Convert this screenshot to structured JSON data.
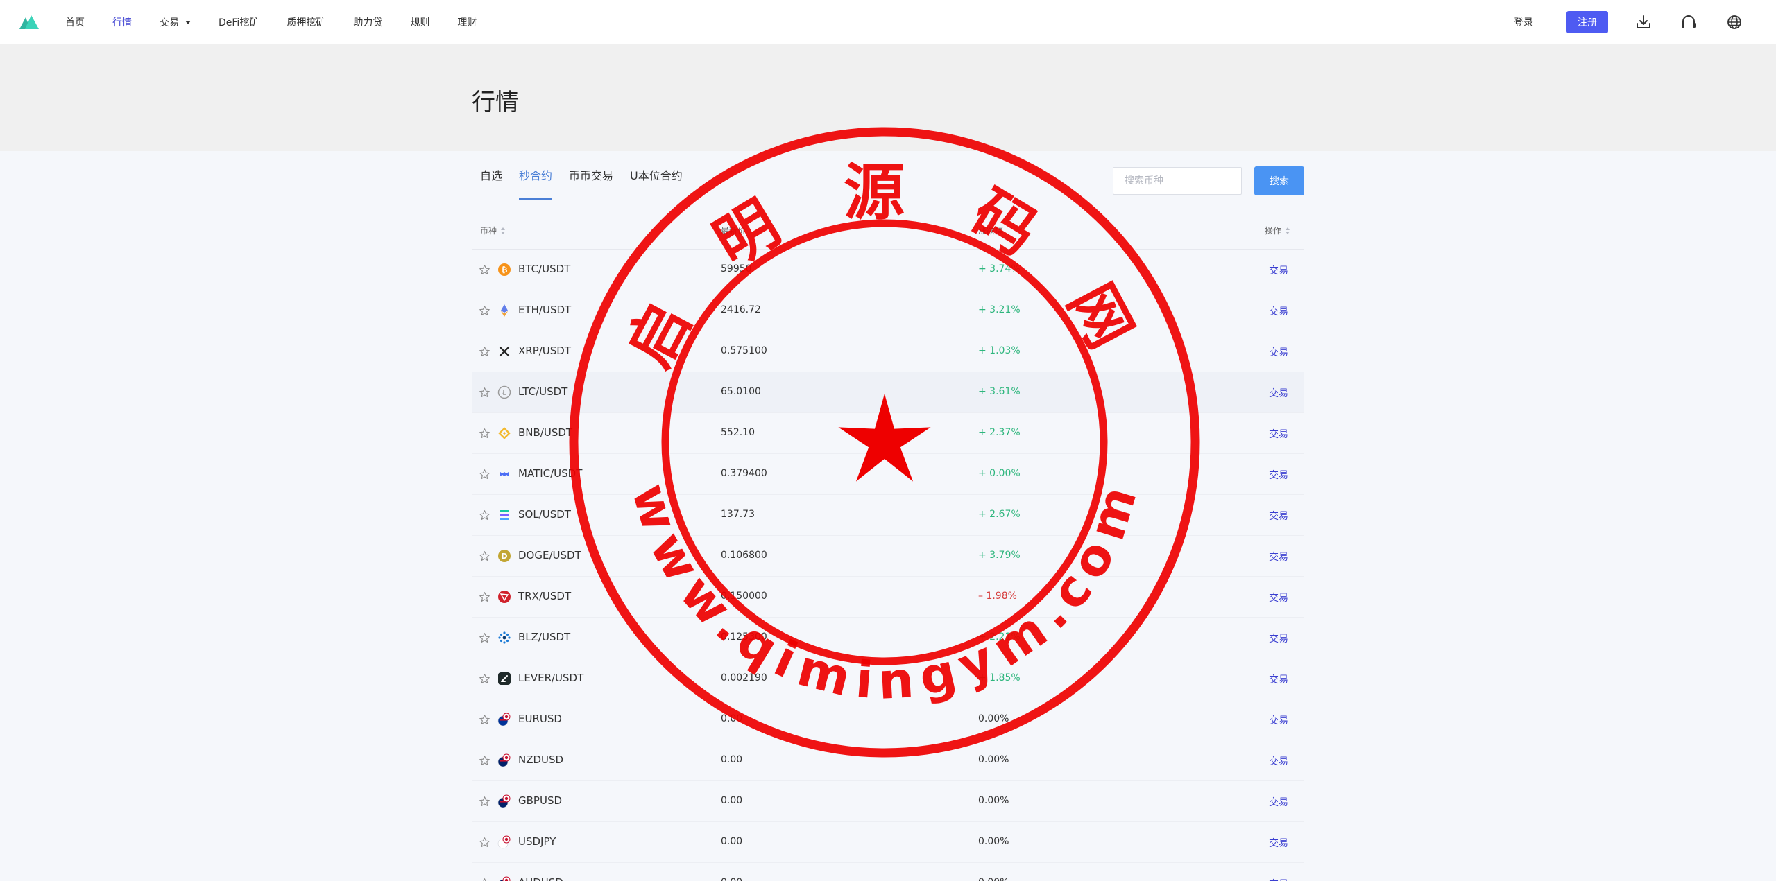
{
  "nav": {
    "items": [
      {
        "label": "首页",
        "active": false,
        "dropdown": false
      },
      {
        "label": "行情",
        "active": true,
        "dropdown": false
      },
      {
        "label": "交易",
        "active": false,
        "dropdown": true
      },
      {
        "label": "DeFi挖矿",
        "active": false,
        "dropdown": false
      },
      {
        "label": "质押挖矿",
        "active": false,
        "dropdown": false
      },
      {
        "label": "助力贷",
        "active": false,
        "dropdown": false
      },
      {
        "label": "规则",
        "active": false,
        "dropdown": false
      },
      {
        "label": "理财",
        "active": false,
        "dropdown": false
      }
    ],
    "login_label": "登录",
    "register_label": "注册",
    "icons": [
      "download-icon",
      "headset-icon",
      "globe-icon"
    ]
  },
  "page": {
    "title": "行情"
  },
  "tabs": [
    {
      "label": "自选",
      "active": false
    },
    {
      "label": "秒合约",
      "active": true
    },
    {
      "label": "币币交易",
      "active": false
    },
    {
      "label": "U本位合约",
      "active": false
    }
  ],
  "search": {
    "placeholder": "搜索币种",
    "button_label": "搜索"
  },
  "table": {
    "headers": {
      "pair": "币种",
      "price": "最新价",
      "change": "涨跌幅",
      "action": "操作"
    },
    "action_label": "交易",
    "rows": [
      {
        "pair": "BTC/USDT",
        "icon": "btc",
        "price": "59950",
        "change": "+ 3.74%",
        "dir": "up"
      },
      {
        "pair": "ETH/USDT",
        "icon": "eth",
        "price": "2416.72",
        "change": "+ 3.21%",
        "dir": "up"
      },
      {
        "pair": "XRP/USDT",
        "icon": "xrp",
        "price": "0.575100",
        "change": "+ 1.03%",
        "dir": "up"
      },
      {
        "pair": "LTC/USDT",
        "icon": "ltc",
        "price": "65.0100",
        "change": "+ 3.61%",
        "dir": "up"
      },
      {
        "pair": "BNB/USDT",
        "icon": "bnb",
        "price": "552.10",
        "change": "+ 2.37%",
        "dir": "up"
      },
      {
        "pair": "MATIC/USDT",
        "icon": "matic",
        "price": "0.379400",
        "change": "+ 0.00%",
        "dir": "up"
      },
      {
        "pair": "SOL/USDT",
        "icon": "sol",
        "price": "137.73",
        "change": "+ 2.67%",
        "dir": "up"
      },
      {
        "pair": "DOGE/USDT",
        "icon": "doge",
        "price": "0.106800",
        "change": "+ 3.79%",
        "dir": "up"
      },
      {
        "pair": "TRX/USDT",
        "icon": "trx",
        "price": "0.150000",
        "change": "– 1.98%",
        "dir": "down"
      },
      {
        "pair": "BLZ/USDT",
        "icon": "blz",
        "price": "0.125300",
        "change": "+ 2.21%",
        "dir": "up"
      },
      {
        "pair": "LEVER/USDT",
        "icon": "lever",
        "price": "0.002190",
        "change": "+ 1.85%",
        "dir": "up"
      },
      {
        "pair": "EURUSD",
        "icon": "eur",
        "price": "0.00",
        "change": "0.00%",
        "dir": "flat"
      },
      {
        "pair": "NZDUSD",
        "icon": "nzd",
        "price": "0.00",
        "change": "0.00%",
        "dir": "flat"
      },
      {
        "pair": "GBPUSD",
        "icon": "gbp",
        "price": "0.00",
        "change": "0.00%",
        "dir": "flat"
      },
      {
        "pair": "USDJPY",
        "icon": "jpy",
        "price": "0.00",
        "change": "0.00%",
        "dir": "flat"
      },
      {
        "pair": "AUDUSD",
        "icon": "aud",
        "price": "0.00",
        "change": "0.00%",
        "dir": "flat"
      }
    ],
    "hover_row": 3
  },
  "colors": {
    "up": "#2eb67d",
    "down": "#d63d3d",
    "accent": "#4e5bf2",
    "link": "#3b3fd1",
    "search_button": "#4a94f3"
  },
  "watermark": {
    "top_text": "启 明 源 码 网",
    "bottom_text": "www.qimingym.com"
  }
}
